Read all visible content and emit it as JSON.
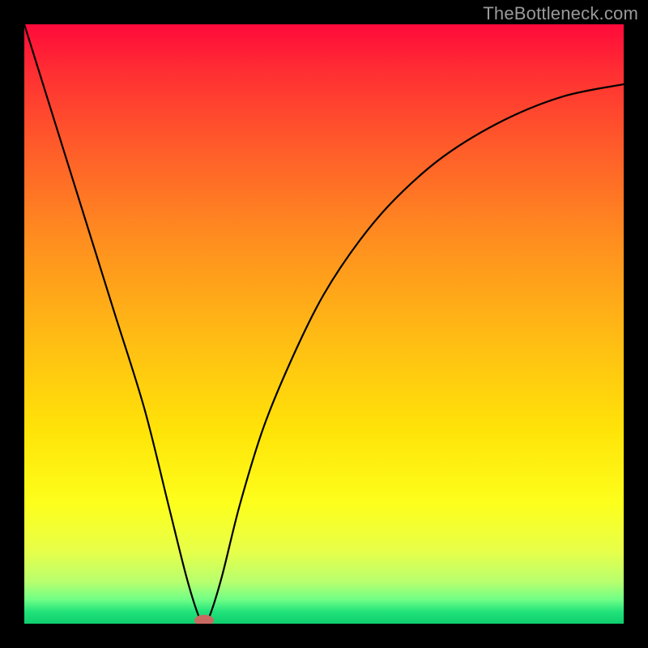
{
  "watermark": "TheBottleneck.com",
  "colors": {
    "frame": "#000000",
    "curve": "#000000",
    "marker": "#c96a62",
    "watermark": "#9a9a9a"
  },
  "chart_data": {
    "type": "line",
    "title": "",
    "xlabel": "",
    "ylabel": "",
    "xlim": [
      0,
      100
    ],
    "ylim": [
      0,
      100
    ],
    "grid": false,
    "legend": false,
    "series": [
      {
        "name": "bottleneck-curve",
        "x": [
          0,
          5,
          10,
          15,
          20,
          24,
          27,
          29,
          30,
          31,
          33,
          36,
          40,
          45,
          50,
          56,
          62,
          70,
          80,
          90,
          100
        ],
        "y": [
          100,
          84,
          68,
          52,
          36,
          20,
          8,
          1.5,
          0,
          1.5,
          8,
          20,
          33,
          45,
          55,
          64,
          71,
          78,
          84,
          88,
          90
        ]
      }
    ],
    "marker": {
      "x": 30,
      "y": 0
    }
  }
}
